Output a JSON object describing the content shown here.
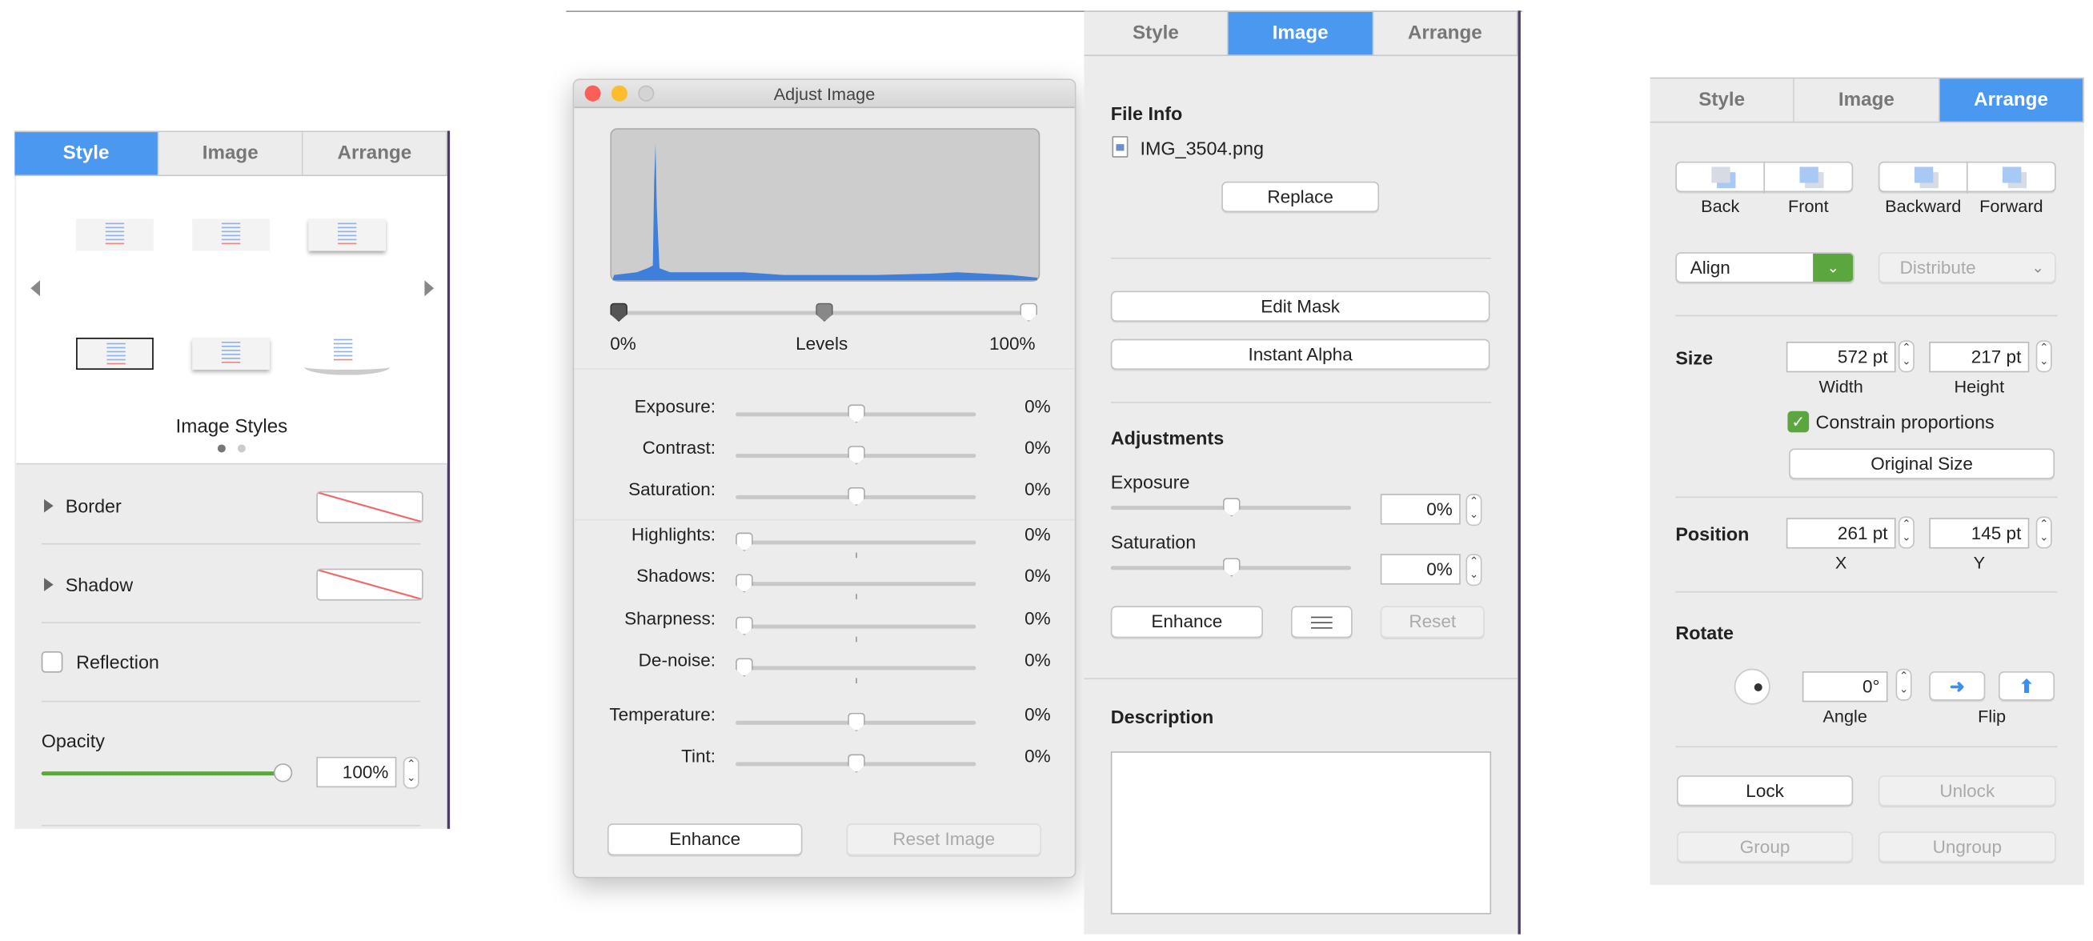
{
  "tabs": [
    "Style",
    "Image",
    "Arrange"
  ],
  "style_panel": {
    "image_styles_label": "Image Styles",
    "border_label": "Border",
    "shadow_label": "Shadow",
    "reflection_label": "Reflection",
    "reflection_checked": false,
    "opacity_label": "Opacity",
    "opacity_value": "100%",
    "opacity_fraction": 1.0,
    "page_indicator": {
      "current": 1,
      "total": 2
    }
  },
  "adjust_dialog": {
    "title": "Adjust Image",
    "levels": {
      "label": "Levels",
      "min": "0%",
      "max": "100%"
    },
    "sliders": [
      {
        "label": "Exposure:",
        "value": "0%"
      },
      {
        "label": "Contrast:",
        "value": "0%"
      },
      {
        "label": "Saturation:",
        "value": "0%"
      },
      {
        "label": "Highlights:",
        "value": "0%"
      },
      {
        "label": "Shadows:",
        "value": "0%"
      },
      {
        "label": "Sharpness:",
        "value": "0%"
      },
      {
        "label": "De-noise:",
        "value": "0%"
      },
      {
        "label": "Temperature:",
        "value": "0%"
      },
      {
        "label": "Tint:",
        "value": "0%"
      }
    ],
    "enhance_label": "Enhance",
    "reset_label": "Reset Image"
  },
  "image_panel": {
    "file_info_label": "File Info",
    "file_name": "IMG_3504.png",
    "replace_label": "Replace",
    "edit_mask_label": "Edit Mask",
    "instant_alpha_label": "Instant Alpha",
    "adjustments_label": "Adjustments",
    "exposure_label": "Exposure",
    "exposure_value": "0%",
    "saturation_label": "Saturation",
    "saturation_value": "0%",
    "enhance_label": "Enhance",
    "reset_label": "Reset",
    "description_label": "Description",
    "description_value": ""
  },
  "arrange_panel": {
    "back_label": "Back",
    "front_label": "Front",
    "backward_label": "Backward",
    "forward_label": "Forward",
    "align_label": "Align",
    "distribute_label": "Distribute",
    "size_label": "Size",
    "width_value": "572 pt",
    "height_value": "217 pt",
    "width_label": "Width",
    "height_label": "Height",
    "constrain_label": "Constrain proportions",
    "constrain_checked": true,
    "original_size_label": "Original Size",
    "position_label": "Position",
    "x_value": "261 pt",
    "y_value": "145 pt",
    "x_label": "X",
    "y_label": "Y",
    "rotate_label": "Rotate",
    "angle_value": "0°",
    "angle_label": "Angle",
    "flip_label": "Flip",
    "lock_label": "Lock",
    "unlock_label": "Unlock",
    "group_label": "Group",
    "ungroup_label": "Ungroup"
  },
  "colors": {
    "accent": "#4a98f0",
    "green": "#5ca640",
    "histogram": "#3f7fdc"
  }
}
